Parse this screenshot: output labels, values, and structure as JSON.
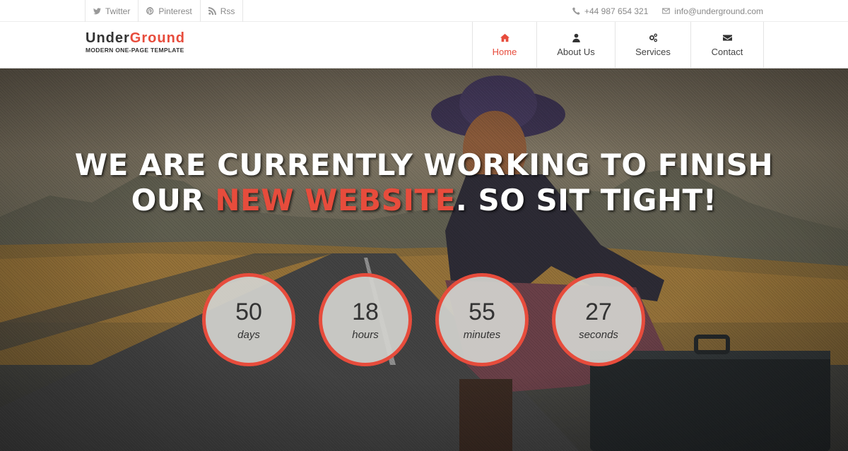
{
  "topbar": {
    "social": [
      {
        "label": "Twitter",
        "icon": "twitter-icon"
      },
      {
        "label": "Pinterest",
        "icon": "pinterest-icon"
      },
      {
        "label": "Rss",
        "icon": "rss-icon"
      }
    ],
    "phone": "+44 987 654 321",
    "email": "info@underground.com"
  },
  "brand": {
    "name_part1": "Under",
    "name_part2": "Ground",
    "tagline": "MODERN ONE-PAGE TEMPLATE",
    "accent_color": "#e74c3c"
  },
  "nav": {
    "items": [
      {
        "label": "Home",
        "icon": "home-icon",
        "active": true
      },
      {
        "label": "About Us",
        "icon": "user-icon",
        "active": false
      },
      {
        "label": "Services",
        "icon": "gears-icon",
        "active": false
      },
      {
        "label": "Contact",
        "icon": "envelope-icon",
        "active": false
      }
    ]
  },
  "hero": {
    "line1": "WE ARE CURRENTLY WORKING TO FINISH",
    "line2_before": "OUR ",
    "line2_highlight": "NEW WEBSITE",
    "line2_after": ". SO SIT TIGHT!"
  },
  "countdown": [
    {
      "value": "50",
      "unit": "days"
    },
    {
      "value": "18",
      "unit": "hours"
    },
    {
      "value": "55",
      "unit": "minutes"
    },
    {
      "value": "27",
      "unit": "seconds"
    }
  ]
}
